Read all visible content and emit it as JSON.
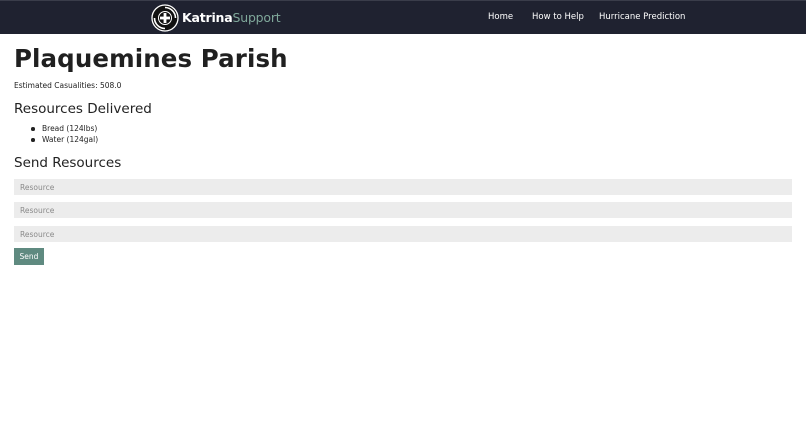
{
  "navbar": {
    "brand": {
      "part1": "Katrina",
      "part2": "Support"
    },
    "links": [
      {
        "label": "Home"
      },
      {
        "label": "How to Help"
      },
      {
        "label": "Hurricane Prediction"
      }
    ]
  },
  "parish": {
    "name": "Plaquemines Parish",
    "casualties_text": "Estimated Casualities: 508.0"
  },
  "delivered": {
    "title": "Resources Delivered",
    "items": [
      {
        "label": "Bread (124lbs)"
      },
      {
        "label": "Water (124gal)"
      }
    ]
  },
  "send": {
    "title": "Send Resources",
    "inputs": [
      {
        "placeholder": "Resource",
        "value": ""
      },
      {
        "placeholder": "Resource",
        "value": ""
      },
      {
        "placeholder": "Resource",
        "value": ""
      }
    ],
    "button_label": "Send"
  },
  "colors": {
    "navbar_bg": "#1f2230",
    "brand_accent": "#7fa79a",
    "button_bg": "#5f8a80",
    "input_bg": "#ececec"
  },
  "icons": {
    "logo": "hurricane-cross-logo-icon"
  }
}
